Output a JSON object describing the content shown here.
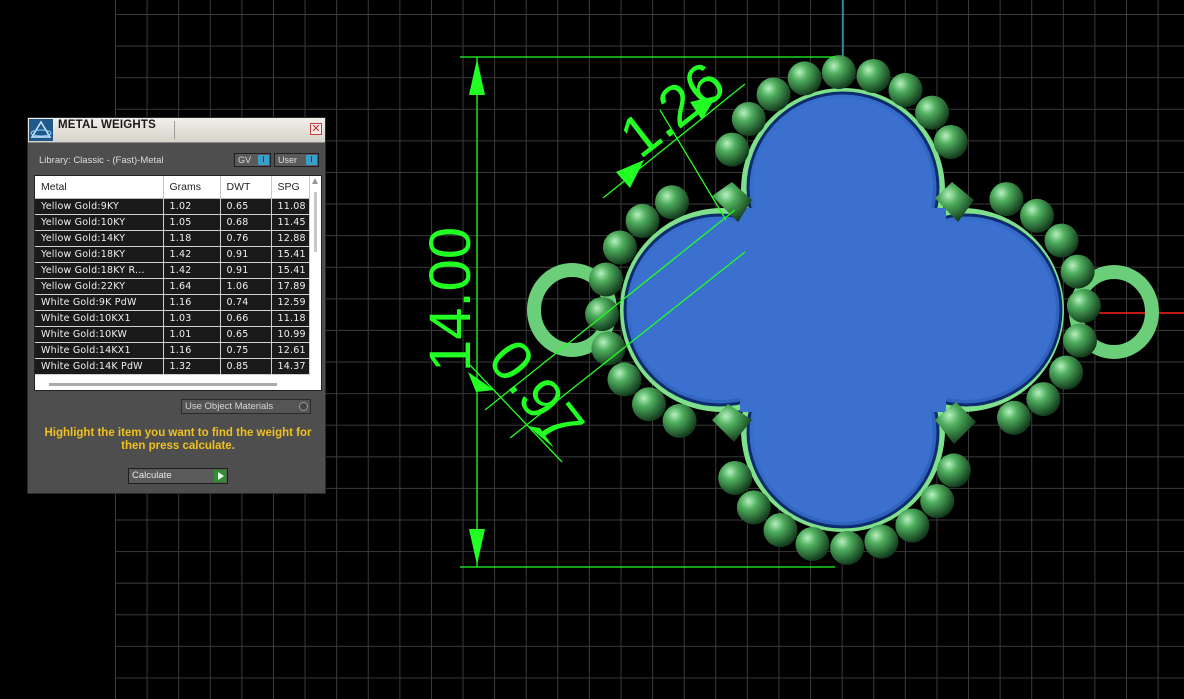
{
  "viewport": {
    "dimensions": [
      {
        "label": "1.26"
      },
      {
        "label": "14.00"
      },
      {
        "label": "0.97"
      }
    ],
    "colors": {
      "dimension": "#22ff22",
      "body": "#2f66c4",
      "metal": "#3f9a50",
      "axis_x": "#ff2020",
      "axis_y": "#2aa0c0"
    }
  },
  "panel": {
    "title": "METAL WEIGHTS",
    "close_glyph": "✕",
    "library": "Library: Classic - (Fast)-Metal",
    "toggles": {
      "gv": "GV",
      "user": "User"
    },
    "columns": [
      "Metal",
      "Grams",
      "DWT",
      "SPG"
    ],
    "rows": [
      [
        "Yellow Gold:9KY",
        "1.02",
        "0.65",
        "11.08"
      ],
      [
        "Yellow Gold:10KY",
        "1.05",
        "0.68",
        "11.45"
      ],
      [
        "Yellow Gold:14KY",
        "1.18",
        "0.76",
        "12.88"
      ],
      [
        "Yellow Gold:18KY",
        "1.42",
        "0.91",
        "15.41"
      ],
      [
        "Yellow Gold:18KY R...",
        "1.42",
        "0.91",
        "15.41"
      ],
      [
        "Yellow Gold:22KY",
        "1.64",
        "1.06",
        "17.89"
      ],
      [
        "White Gold:9K PdW",
        "1.16",
        "0.74",
        "12.59"
      ],
      [
        "White Gold:10KX1",
        "1.03",
        "0.66",
        "11.18"
      ],
      [
        "White Gold:10KW",
        "1.01",
        "0.65",
        "10.99"
      ],
      [
        "White Gold:14KX1",
        "1.16",
        "0.75",
        "12.61"
      ],
      [
        "White Gold:14K PdW",
        "1.32",
        "0.85",
        "14.37"
      ]
    ],
    "use_object_materials": "Use Object Materials",
    "instructions": "Highlight the item you want to find the weight for then press calculate.",
    "calculate": "Calculate",
    "accent": "#f0c020"
  }
}
